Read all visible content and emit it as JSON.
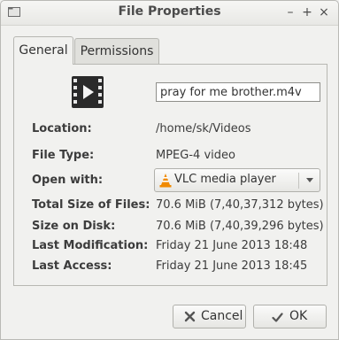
{
  "window": {
    "title": "File Properties"
  },
  "titlebar_buttons": {
    "minimize": "–",
    "maximize": "+",
    "close": "×"
  },
  "tabs": [
    {
      "label": "General",
      "selected": true
    },
    {
      "label": "Permissions",
      "selected": false
    }
  ],
  "file": {
    "name": "pray for me brother.m4v",
    "icon": "video-file-icon"
  },
  "properties": {
    "location_label": "Location:",
    "location_value": "/home/sk/Videos",
    "filetype_label": "File Type:",
    "filetype_value": "MPEG-4 video",
    "openwith_label": "Open with:",
    "openwith_value": "VLC media player",
    "openwith_icon": "vlc-icon",
    "totalsize_label": "Total Size of Files:",
    "totalsize_value": "70.6 MiB (7,40,37,312 bytes)",
    "disksize_label": "Size on Disk:",
    "disksize_value": "70.6 MiB (7,40,39,296 bytes)",
    "modified_label": "Last Modification:",
    "modified_value": "Friday 21 June 2013 18:48",
    "access_label": "Last Access:",
    "access_value": "Friday 21 June 2013 18:45"
  },
  "buttons": {
    "cancel": "Cancel",
    "ok": "OK"
  },
  "colors": {
    "background": "#f1f1ef",
    "vlc_orange": "#f08a00",
    "cancel_icon": "#555555"
  }
}
